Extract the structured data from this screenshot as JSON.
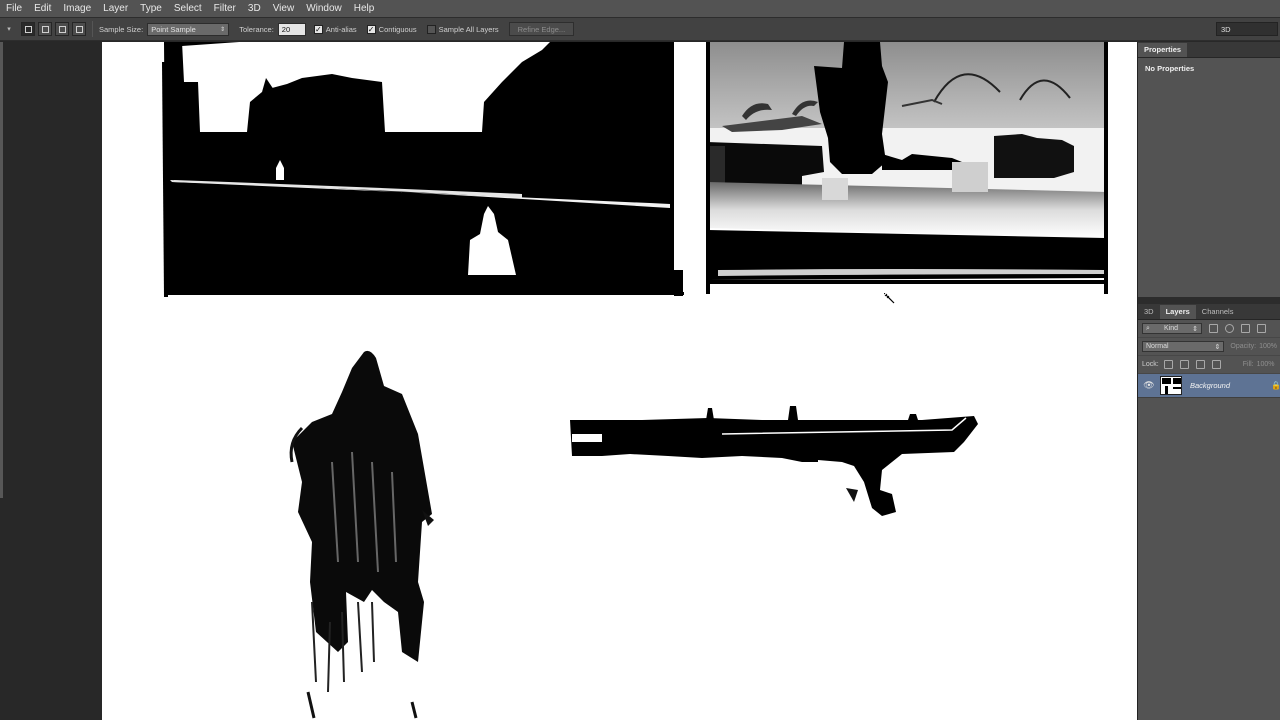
{
  "menu": [
    "File",
    "Edit",
    "Image",
    "Layer",
    "Type",
    "Select",
    "Filter",
    "3D",
    "View",
    "Window",
    "Help"
  ],
  "options": {
    "sample_size_label": "Sample Size:",
    "sample_size_value": "Point Sample",
    "tolerance_label": "Tolerance:",
    "tolerance_value": "20",
    "anti_alias": "Anti-alias",
    "contiguous": "Contiguous",
    "sample_all_layers": "Sample All Layers",
    "refine_edge": "Refine Edge...",
    "workspace": "3D"
  },
  "properties": {
    "tab": "Properties",
    "body": "No Properties"
  },
  "layers_panel": {
    "tabs": [
      "3D",
      "Layers",
      "Channels"
    ],
    "filter_kind": "Kind",
    "blend_mode": "Normal",
    "opacity_label": "Opacity:",
    "opacity_value": "100%",
    "lock_label": "Lock:",
    "fill_label": "Fill:",
    "fill_value": "100%",
    "layer_name": "Background"
  },
  "icons": {
    "cursor": "magic-wand-cursor",
    "visibility": "eye-icon",
    "lock": "lock-icon"
  },
  "colors": {
    "menubar": "#535353",
    "optbar": "#424242",
    "panel": "#535353",
    "selected_layer": "#5e7394"
  }
}
